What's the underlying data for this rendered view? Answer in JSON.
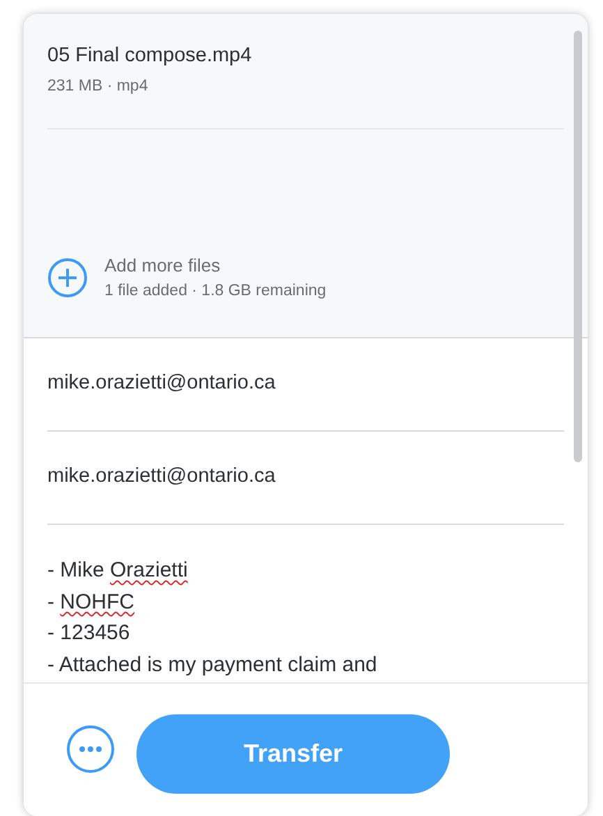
{
  "files": [
    {
      "name": "05 Final compose.mp4",
      "details": "231 MB · mp4"
    }
  ],
  "add_files": {
    "label": "Add more files",
    "status": "1 file added · 1.8 GB remaining"
  },
  "to_field": {
    "value": "mike.orazietti@ontario.ca"
  },
  "from_field": {
    "value": "mike.orazietti@ontario.ca"
  },
  "message": {
    "lines": [
      [
        {
          "text": "- Mike "
        },
        {
          "text": "Orazietti",
          "misspelled": true
        }
      ],
      [
        {
          "text": "- "
        },
        {
          "text": "NOHFC",
          "misspelled": true
        }
      ],
      [
        {
          "text": "- 123456"
        }
      ],
      [
        {
          "text": "- Attached is my payment claim and"
        }
      ]
    ]
  },
  "footer": {
    "transfer_button": "Transfer"
  }
}
